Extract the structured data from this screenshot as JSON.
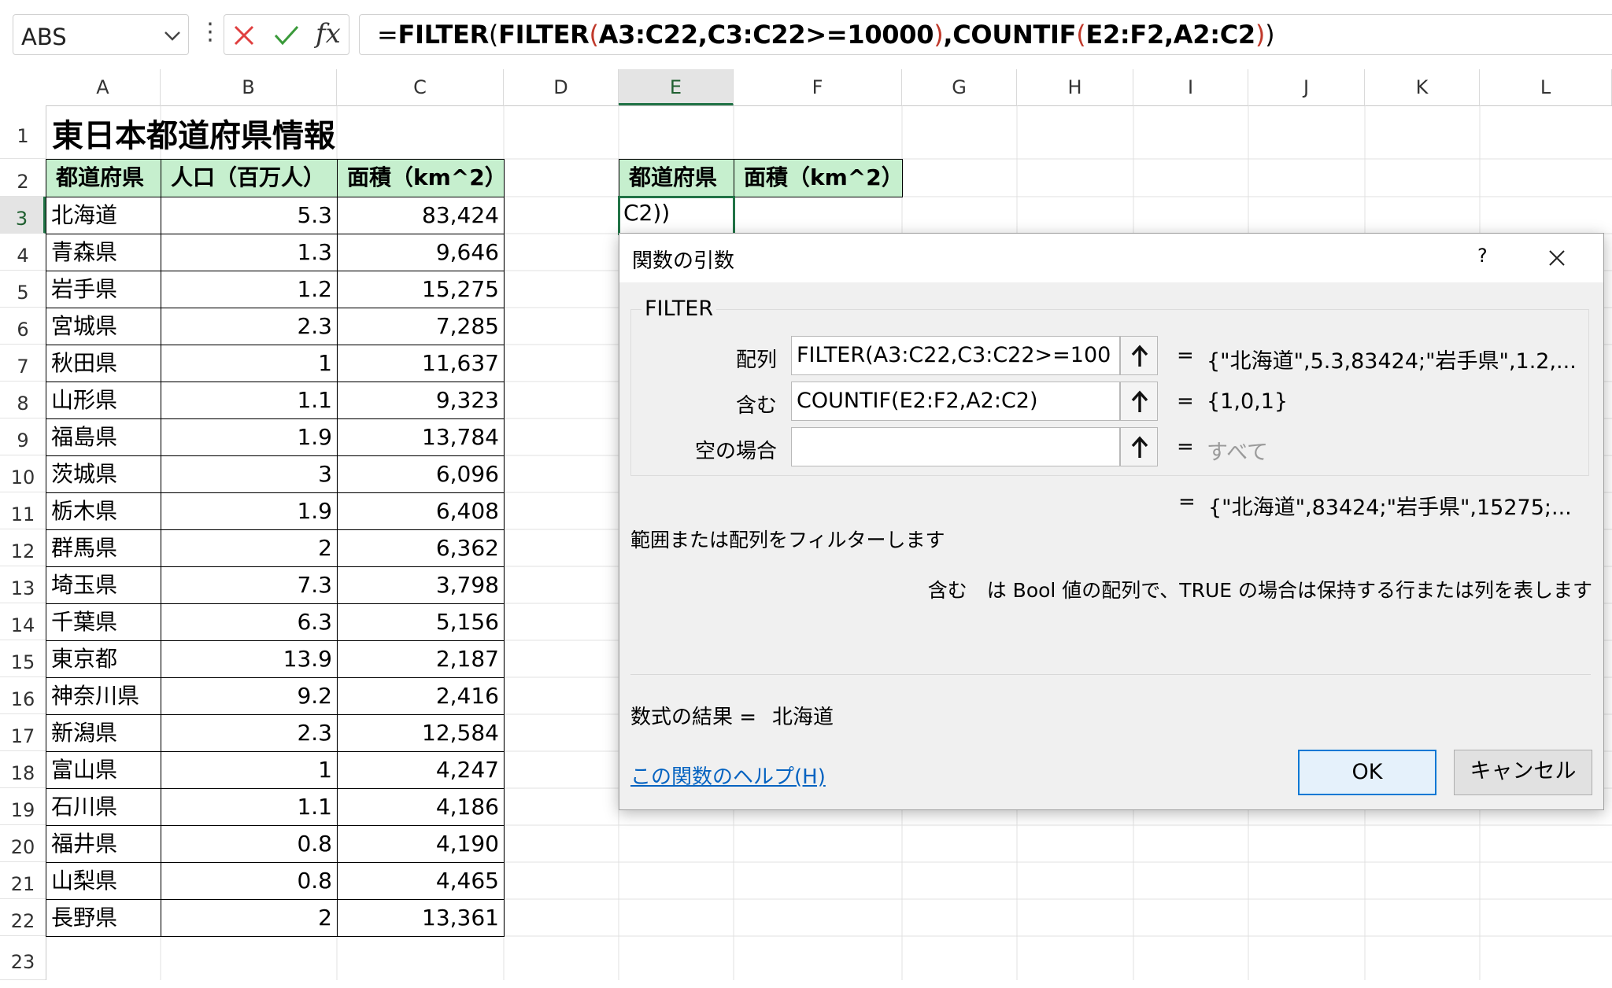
{
  "formula_bar": {
    "name_box": "ABS",
    "more": "⋮",
    "fx": "fx",
    "formula_parts": [
      {
        "text": "=",
        "style": "normal"
      },
      {
        "text": "FILTER",
        "style": "bold"
      },
      {
        "text": "(",
        "style": "normal"
      },
      {
        "text": "FILTER",
        "style": "bold"
      },
      {
        "text": "(",
        "style": "red"
      },
      {
        "text": "A3:C22,C3:C22>=10000",
        "style": "bold"
      },
      {
        "text": ")",
        "style": "red"
      },
      {
        "text": ",COUNTIF",
        "style": "bold"
      },
      {
        "text": "(",
        "style": "red"
      },
      {
        "text": "E2:F2,A2:C2",
        "style": "bold"
      },
      {
        "text": ")",
        "style": "red"
      },
      {
        "text": ")",
        "style": "normal"
      }
    ]
  },
  "columns": [
    "A",
    "B",
    "C",
    "D",
    "E",
    "F",
    "G",
    "H",
    "I",
    "J",
    "K",
    "L"
  ],
  "selected_column": "E",
  "rows": [
    "1",
    "2",
    "3",
    "4",
    "5",
    "6",
    "7",
    "8",
    "9",
    "10",
    "11",
    "12",
    "13",
    "14",
    "15",
    "16",
    "17",
    "18",
    "19",
    "20",
    "21",
    "22",
    "23"
  ],
  "selected_row": "3",
  "sheet": {
    "title": "東日本都道府県情報",
    "headers": [
      "都道府県",
      "人口（百万人）",
      "面積（km^2）"
    ],
    "data": [
      [
        "北海道",
        "5.3",
        "83,424"
      ],
      [
        "青森県",
        "1.3",
        "9,646"
      ],
      [
        "岩手県",
        "1.2",
        "15,275"
      ],
      [
        "宮城県",
        "2.3",
        "7,285"
      ],
      [
        "秋田県",
        "1",
        "11,637"
      ],
      [
        "山形県",
        "1.1",
        "9,323"
      ],
      [
        "福島県",
        "1.9",
        "13,784"
      ],
      [
        "茨城県",
        "3",
        "6,096"
      ],
      [
        "栃木県",
        "1.9",
        "6,408"
      ],
      [
        "群馬県",
        "2",
        "6,362"
      ],
      [
        "埼玉県",
        "7.3",
        "3,798"
      ],
      [
        "千葉県",
        "6.3",
        "5,156"
      ],
      [
        "東京都",
        "13.9",
        "2,187"
      ],
      [
        "神奈川県",
        "9.2",
        "2,416"
      ],
      [
        "新潟県",
        "2.3",
        "12,584"
      ],
      [
        "富山県",
        "1",
        "4,247"
      ],
      [
        "石川県",
        "1.1",
        "4,186"
      ],
      [
        "福井県",
        "0.8",
        "4,190"
      ],
      [
        "山梨県",
        "0.8",
        "4,465"
      ],
      [
        "長野県",
        "2",
        "13,361"
      ]
    ],
    "filter_headers": [
      "都道府県",
      "面積（km^2）"
    ],
    "active_cell_text": "C2))"
  },
  "dialog": {
    "title": "関数の引数",
    "help": "?",
    "function_name": "FILTER",
    "args": [
      {
        "label": "配列",
        "input": "FILTER(A3:C22,C3:C22>=100",
        "eq": "=",
        "value": "{\"北海道\",5.3,83424;\"岩手県\",1.2,...",
        "placeholder": false
      },
      {
        "label": "含む",
        "input": "COUNTIF(E2:F2,A2:C2)",
        "eq": "=",
        "value": "{1,0,1}",
        "placeholder": false
      },
      {
        "label": "空の場合",
        "input": "",
        "eq": "=",
        "value": "すべて",
        "placeholder": true
      }
    ],
    "result_eq": "=",
    "result_value": "{\"北海道\",83424;\"岩手県\",15275;...",
    "description": "範囲または配列をフィルターします",
    "arg_help": "含む　は Bool 値の配列で、TRUE の場合は保持する行または列を表します",
    "formula_result_label": "数式の結果 =",
    "formula_result_value": "北海道",
    "help_link": "この関数のヘルプ(H)",
    "ok_label": "OK",
    "cancel_label": "キャンセル"
  },
  "colors": {
    "header_fill": "#c6efce",
    "accent": "#217346",
    "link": "#0563c1",
    "error_red": "#c0392b"
  },
  "icons": {
    "name_box_dropdown": "chevron-down-icon",
    "cancel": "x-icon",
    "enter": "check-icon",
    "ref_button": "arrow-up-icon",
    "close": "close-icon"
  }
}
